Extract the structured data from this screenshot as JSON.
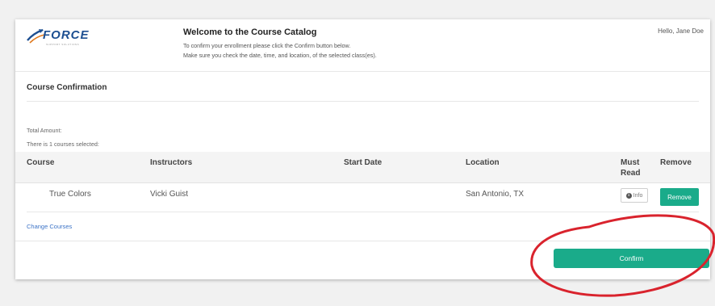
{
  "header": {
    "logo_text": "FORCE",
    "logo_subtext": "SUPPORT SOLUTIONS",
    "welcome_title": "Welcome to the Course Catalog",
    "welcome_line_1": "To confirm your enrollment please click the Confirm button below.",
    "welcome_line_2": "Make sure you check the date, time, and location, of the selected class(es).",
    "greeting": "Hello, Jane Doe"
  },
  "section": {
    "title": "Course Confirmation",
    "total_amount_label": "Total Amount:",
    "selected_text": "There is 1 courses selected:"
  },
  "table": {
    "headers": {
      "course": "Course",
      "instructors": "Instructors",
      "start_date": "Start Date",
      "location": "Location",
      "must_read_1": "Must",
      "must_read_2": "Read",
      "remove": "Remove"
    },
    "rows": [
      {
        "course": "True Colors",
        "instructors": "Vicki Guist",
        "start_date": "",
        "location": "San Antonio, TX",
        "info_label": "Info",
        "remove_label": "Remove"
      }
    ]
  },
  "actions": {
    "change_courses": "Change Courses",
    "confirm": "Confirm"
  },
  "colors": {
    "accent_green": "#1aab8a",
    "link_blue": "#3d74c7",
    "annotation_red": "#d9232d",
    "logo_blue": "#1d4f91"
  },
  "icons": {
    "logo": "force-logo-swoosh",
    "info": "info-circle-icon",
    "annotation": "red-highlight-ellipse"
  }
}
